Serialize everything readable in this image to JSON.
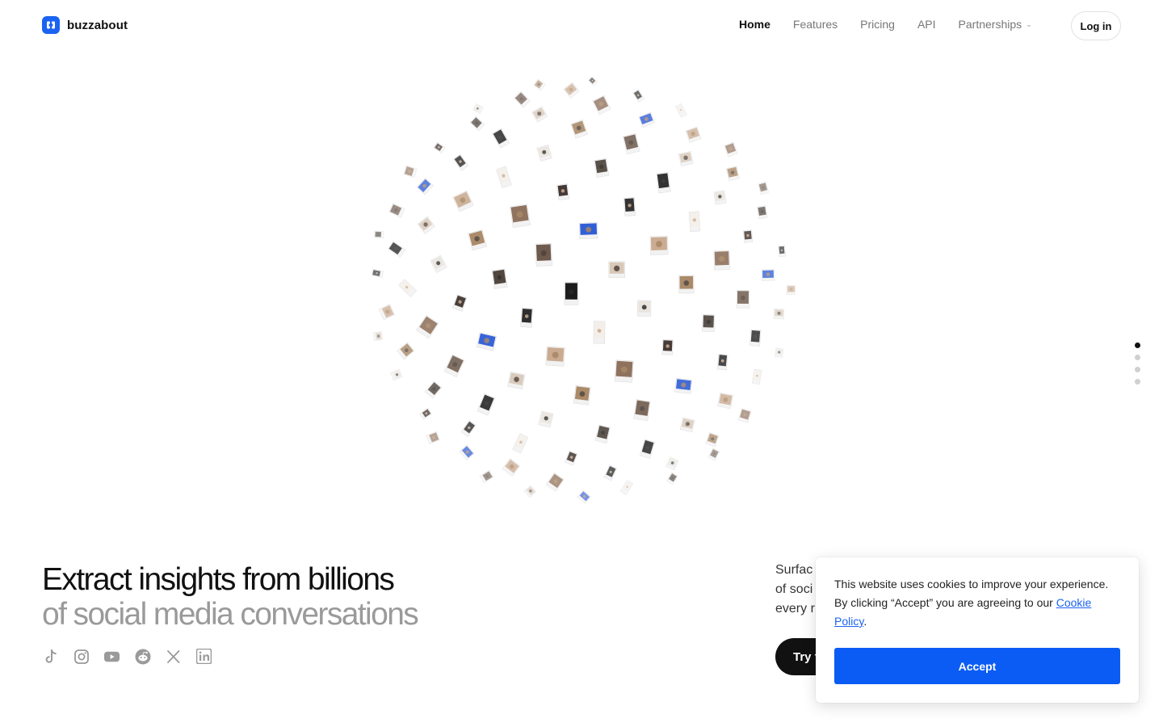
{
  "brand": {
    "name": "buzzabout"
  },
  "nav": {
    "items": [
      {
        "label": "Home",
        "active": true
      },
      {
        "label": "Features"
      },
      {
        "label": "Pricing"
      },
      {
        "label": "API"
      },
      {
        "label": "Partnerships",
        "has_dropdown": true
      }
    ],
    "login_label": "Log in"
  },
  "pager": {
    "count": 4,
    "active_index": 0
  },
  "hero": {
    "headline_line1": "Extract insights from billions",
    "headline_line2": "of social media conversations",
    "socials": [
      "tiktok-icon",
      "instagram-icon",
      "youtube-icon",
      "reddit-icon",
      "x-icon",
      "linkedin-icon"
    ],
    "subcopy_line1": "Surfac",
    "subcopy_line2": "of soci",
    "subcopy_line3": "every r",
    "cta_label": "Try f"
  },
  "cookie": {
    "text_before_link": "This website uses cookies to improve your experience. By clicking “Accept” you are agreeing to our ",
    "link_text": "Cookie Policy",
    "text_after_link": ".",
    "accept_label": "Accept"
  },
  "colors": {
    "brand_blue": "#1b63f2",
    "accept_blue": "#0b5cf5",
    "headline_gray": "#9a9a9a"
  }
}
